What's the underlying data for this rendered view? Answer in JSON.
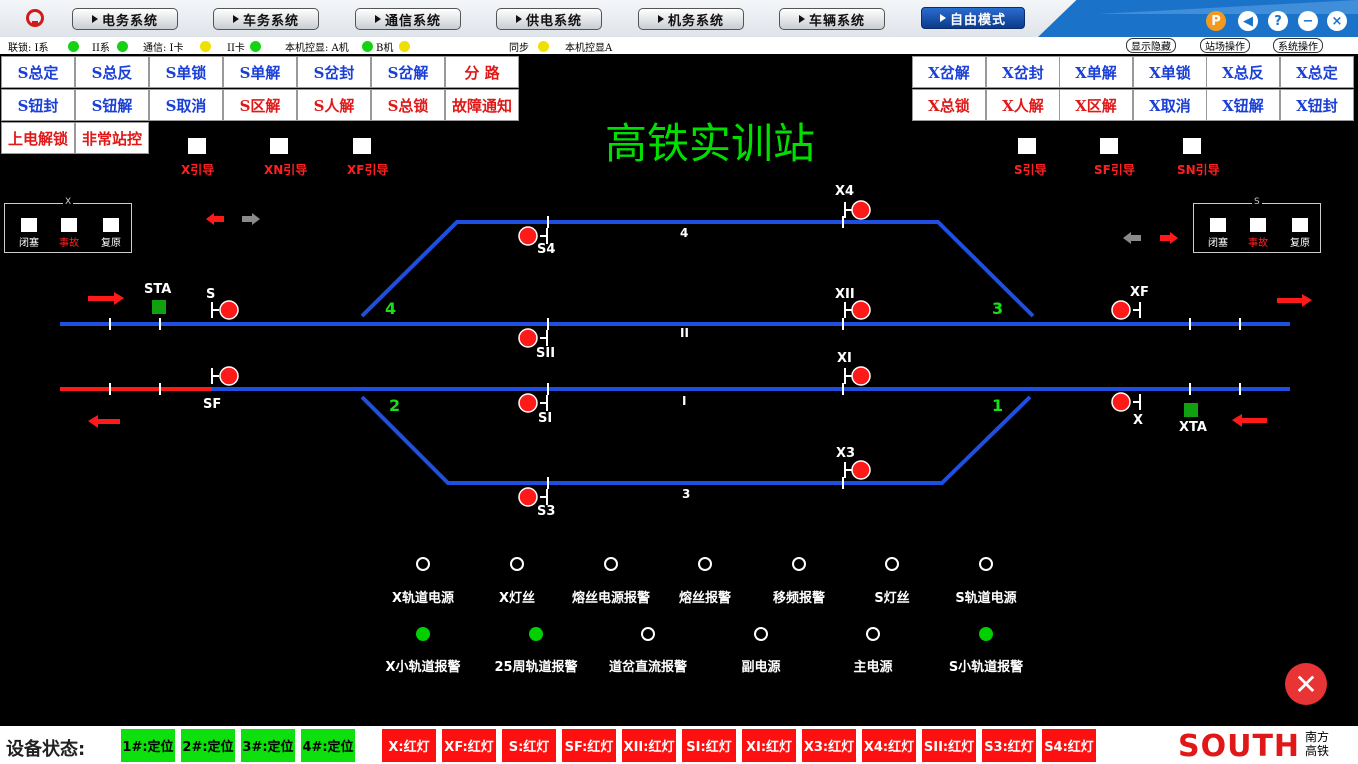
{
  "topbar": {
    "systems": [
      "电务系统",
      "车务系统",
      "通信系统",
      "供电系统",
      "机务系统",
      "车辆系统"
    ],
    "free_mode": "自由模式",
    "window_buttons": [
      "P",
      "◀",
      "?",
      "−",
      "×"
    ]
  },
  "status": {
    "items": [
      {
        "label": "联锁: I系",
        "led": "#16d116"
      },
      {
        "label": "II系",
        "led": "#16d116"
      },
      {
        "label": "通信: I卡",
        "led": "#f0e000"
      },
      {
        "label": "II卡",
        "led": "#16d116"
      },
      {
        "label": "本机控显: A机",
        "led": "#16d116"
      },
      {
        "label": "B机",
        "led": "#f0e000"
      },
      {
        "label": "同步",
        "led": "#f0e000"
      },
      {
        "label": "本机控显A",
        "led": ""
      }
    ],
    "buttons": [
      "显示隐藏",
      "站场操作",
      "系统操作"
    ]
  },
  "commands_left": [
    [
      {
        "t": "S总定",
        "c": "#1a3fd6"
      },
      {
        "t": "S总反",
        "c": "#1a3fd6"
      },
      {
        "t": "S单锁",
        "c": "#1a3fd6"
      },
      {
        "t": "S单解",
        "c": "#1a3fd6"
      },
      {
        "t": "S岔封",
        "c": "#1a3fd6"
      },
      {
        "t": "S岔解",
        "c": "#1a3fd6"
      },
      {
        "t": "分 路",
        "c": "#e01818"
      }
    ],
    [
      {
        "t": "S钮封",
        "c": "#1a3fd6"
      },
      {
        "t": "S钮解",
        "c": "#1a3fd6"
      },
      {
        "t": "S取消",
        "c": "#1a3fd6"
      },
      {
        "t": "S区解",
        "c": "#e01818"
      },
      {
        "t": "S人解",
        "c": "#e01818"
      },
      {
        "t": "S总锁",
        "c": "#e01818"
      },
      {
        "t": "故障通知",
        "c": "#e01818"
      }
    ],
    [
      {
        "t": "上电解锁",
        "c": "#e01818"
      },
      {
        "t": "非常站控",
        "c": "#e01818"
      }
    ]
  ],
  "commands_right": [
    [
      {
        "t": "X岔解",
        "c": "#1a3fd6"
      },
      {
        "t": "X岔封",
        "c": "#1a3fd6"
      },
      {
        "t": "X单解",
        "c": "#1a3fd6"
      },
      {
        "t": "X单锁",
        "c": "#1a3fd6"
      },
      {
        "t": "X总反",
        "c": "#1a3fd6"
      },
      {
        "t": "X总定",
        "c": "#1a3fd6"
      }
    ],
    [
      {
        "t": "X总锁",
        "c": "#e01818"
      },
      {
        "t": "X人解",
        "c": "#e01818"
      },
      {
        "t": "X区解",
        "c": "#e01818"
      },
      {
        "t": "X取消",
        "c": "#1a3fd6"
      },
      {
        "t": "X钮解",
        "c": "#1a3fd6"
      },
      {
        "t": "X钮封",
        "c": "#1a3fd6"
      }
    ]
  ],
  "station_title": "高铁实训站",
  "guides_left": [
    "X引导",
    "XN引导",
    "XF引导"
  ],
  "guides_right": [
    "S引导",
    "SF引导",
    "SN引导"
  ],
  "block_left": {
    "title": "X",
    "items": [
      "闭塞",
      "事故",
      "复原"
    ]
  },
  "block_right": {
    "title": "S",
    "items": [
      "闭塞",
      "事故",
      "复原"
    ]
  },
  "tracks": {
    "t4": "4",
    "t2": "II",
    "t1": "I",
    "t3": "3"
  },
  "switches": {
    "sw4": "4",
    "sw3": "3",
    "sw2": "2",
    "sw1": "1"
  },
  "signals": {
    "X4": "X4",
    "S4": "S4",
    "S": "S",
    "XII": "XII",
    "XF": "XF",
    "SII": "SII",
    "XI": "XI",
    "SF": "SF",
    "SI": "SI",
    "X": "X",
    "X3": "X3",
    "S3": "S3",
    "STA": "STA",
    "XTA": "XTA"
  },
  "lamps_row1": [
    {
      "label": "X轨道电源",
      "on": false
    },
    {
      "label": "X灯丝",
      "on": false
    },
    {
      "label": "熔丝电源报警",
      "on": false
    },
    {
      "label": "熔丝报警",
      "on": false
    },
    {
      "label": "移频报警",
      "on": false
    },
    {
      "label": "S灯丝",
      "on": false
    },
    {
      "label": "S轨道电源",
      "on": false
    }
  ],
  "lamps_row2": [
    {
      "label": "X小轨道报警",
      "on": true
    },
    {
      "label": "25周轨道报警",
      "on": true
    },
    {
      "label": "道岔直流报警",
      "on": false
    },
    {
      "label": "副电源",
      "on": false
    },
    {
      "label": "主电源",
      "on": false
    },
    {
      "label": "S小轨道报警",
      "on": true
    }
  ],
  "device_status": {
    "title": "设备状态:",
    "green": [
      "1#:定位",
      "2#:定位",
      "3#:定位",
      "4#:定位"
    ],
    "red": [
      "X:红灯",
      "XF:红灯",
      "S:红灯",
      "SF:红灯",
      "XII:红灯",
      "SI:红灯",
      "XI:红灯",
      "X3:红灯",
      "X4:红灯",
      "SII:红灯",
      "S3:红灯",
      "S4:红灯"
    ]
  },
  "brand": {
    "logo": "SOUTH",
    "sub1": "南方",
    "sub2": "高铁"
  }
}
